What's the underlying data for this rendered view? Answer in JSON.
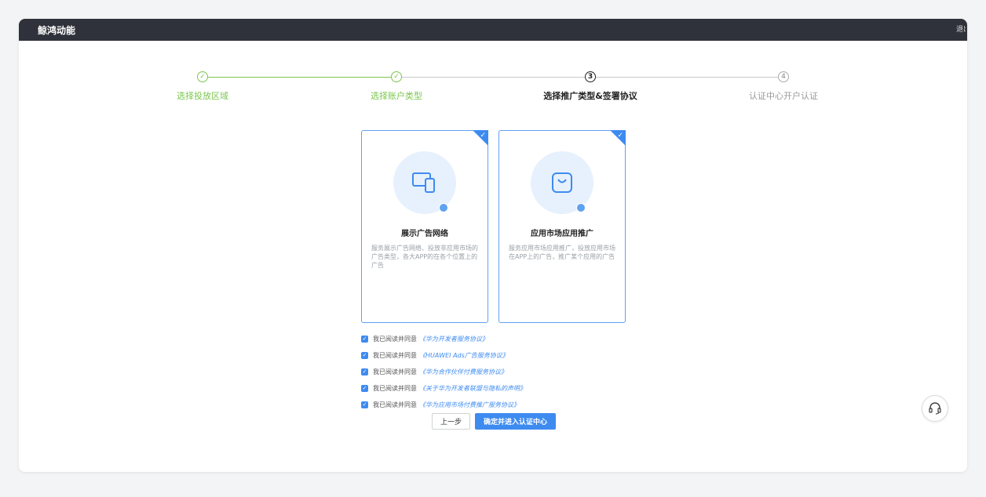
{
  "app": {
    "brand": "鲸鸿动能",
    "exit_label": "退出"
  },
  "steps": [
    {
      "label": "选择投放区域",
      "state": "done",
      "marker": "✓"
    },
    {
      "label": "选择账户类型",
      "state": "done",
      "marker": "✓"
    },
    {
      "label": "选择推广类型&签署协议",
      "state": "active",
      "marker": "3"
    },
    {
      "label": "认证中心开户认证",
      "state": "todo",
      "marker": "4"
    }
  ],
  "cards": [
    {
      "title": "展示广告网络",
      "description": "服务展示广告网络、投放非应用市场的广告类型，各大APP的在各个位置上的广告",
      "icon": "devices-icon",
      "selected": true
    },
    {
      "title": "应用市场应用推广",
      "description": "服务应用市场应用推广，投放应用市场在APP上的广告，推广某个应用的广告",
      "icon": "app-store-bag-icon",
      "selected": true
    }
  ],
  "agreements": [
    {
      "prefix": "我已阅读并同意",
      "link": "《华为开发者服务协议》",
      "checked": true
    },
    {
      "prefix": "我已阅读并同意",
      "link": "《HUAWEI Ads广告服务协议》",
      "checked": true
    },
    {
      "prefix": "我已阅读并同意",
      "link": "《华为合作伙伴付费服务协议》",
      "checked": true
    },
    {
      "prefix": "我已阅读并同意",
      "link": "《关于华为开发者联盟与隐私的声明》",
      "checked": true
    },
    {
      "prefix": "我已阅读并同意",
      "link": "《华为应用市场付费推广服务协议》",
      "checked": true
    }
  ],
  "buttons": {
    "prev": "上一步",
    "confirm": "确定并进入认证中心"
  },
  "colors": {
    "primary": "#3e8bf0",
    "success": "#7ac74f",
    "topbar": "#2f323a"
  }
}
